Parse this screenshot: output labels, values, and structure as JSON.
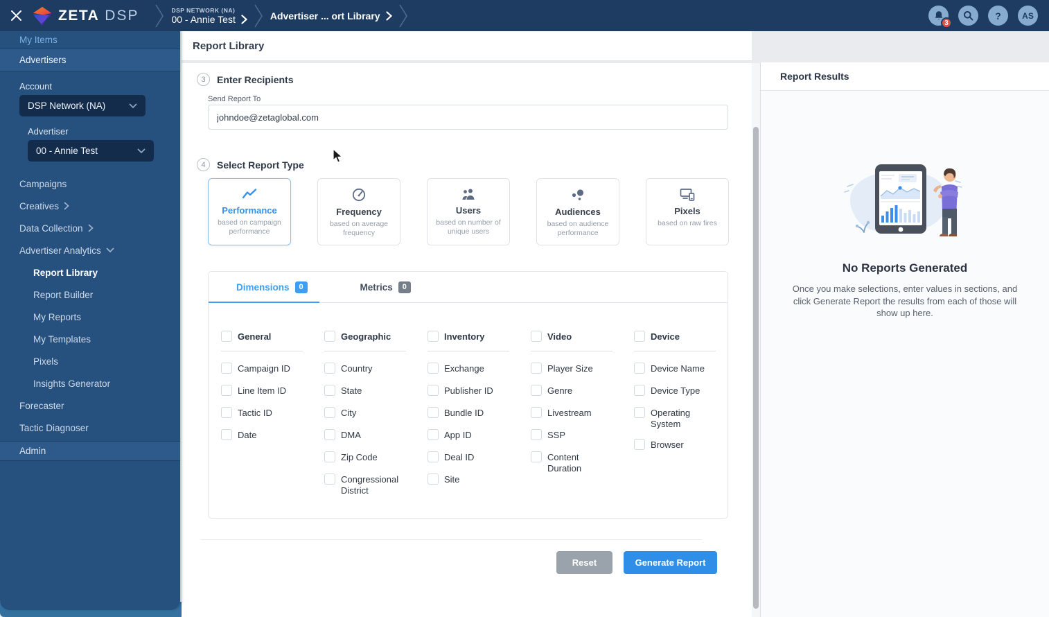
{
  "colors": {
    "topbar": "#1e3c62",
    "sidebar": "#26507e",
    "accent_blue": "#3392ec",
    "badge_red": "#d9534a",
    "button_gray": "#9aa2ac"
  },
  "topbar": {
    "brand_name": "ZETA",
    "brand_suffix": "DSP",
    "breadcrumbs": [
      {
        "eyebrow": "DSP NETWORK (NA)",
        "label": "00 - Annie Test"
      },
      {
        "label": "Advertiser ... ort Library"
      }
    ],
    "notifications_count": "3",
    "avatar_initials": "AS",
    "help_glyph": "?"
  },
  "sidebar": {
    "my_items_label": "My Items",
    "section_label": "Advertisers",
    "account": {
      "label": "Account",
      "value": "DSP Network (NA)"
    },
    "advertiser": {
      "label": "Advertiser",
      "value": "00 - Annie Test"
    },
    "nav": [
      {
        "label": "Campaigns"
      },
      {
        "label": "Creatives"
      },
      {
        "label": "Data Collection"
      },
      {
        "label": "Advertiser Analytics"
      }
    ],
    "analytics_children": [
      {
        "label": "Report Library"
      },
      {
        "label": "Report Builder"
      },
      {
        "label": "My Reports"
      },
      {
        "label": "My Templates"
      },
      {
        "label": "Pixels"
      },
      {
        "label": "Insights Generator"
      }
    ],
    "nav_bottom": [
      {
        "label": "Forecaster"
      },
      {
        "label": "Tactic Diagnoser"
      }
    ],
    "admin_label": "Admin"
  },
  "main": {
    "page_title": "Report Library",
    "recipients_step": {
      "number": "3",
      "title": "Enter Recipients",
      "field_label": "Send Report To",
      "field_value": "johndoe@zetaglobal.com"
    },
    "report_type_step": {
      "number": "4",
      "title": "Select Report Type"
    },
    "report_types": [
      {
        "label": "Performance",
        "description": "based on campaign performance"
      },
      {
        "label": "Frequency",
        "description": "based on average frequency"
      },
      {
        "label": "Users",
        "description": "based on number of unique users"
      },
      {
        "label": "Audiences",
        "description": "based on audience performance"
      },
      {
        "label": "Pixels",
        "description": "based on raw fires"
      }
    ],
    "tabs": [
      {
        "label": "Dimensions",
        "count": "0"
      },
      {
        "label": "Metrics",
        "count": "0"
      }
    ],
    "dimension_groups": [
      {
        "label": "General",
        "items": [
          "Campaign ID",
          "Line Item ID",
          "Tactic ID",
          "Date"
        ]
      },
      {
        "label": "Geographic",
        "items": [
          "Country",
          "State",
          "City",
          "DMA",
          "Zip Code",
          "Congressional District"
        ]
      },
      {
        "label": "Inventory",
        "items": [
          "Exchange",
          "Publisher ID",
          "Bundle ID",
          "App ID",
          "Deal ID",
          "Site"
        ]
      },
      {
        "label": "Video",
        "items": [
          "Player Size",
          "Genre",
          "Livestream",
          "SSP",
          "Content Duration"
        ]
      },
      {
        "label": "Device",
        "items": [
          "Device Name",
          "Device Type",
          "Operating System",
          "Browser"
        ]
      }
    ],
    "actions": {
      "reset_label": "Reset",
      "generate_label": "Generate Report"
    }
  },
  "results_panel": {
    "title": "Report Results",
    "empty_title": "No Reports Generated",
    "empty_message": "Once you make selections, enter values in sections, and click Generate Report the results from each of those will show up here."
  }
}
